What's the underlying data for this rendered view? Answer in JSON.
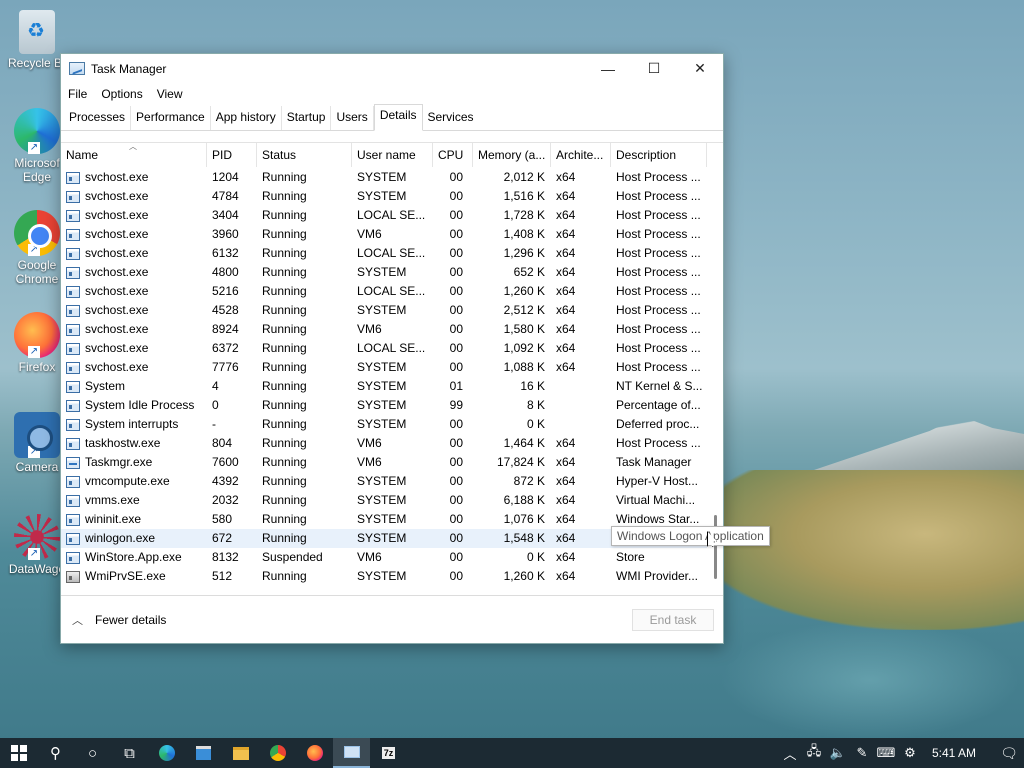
{
  "desktop": {
    "icons": [
      {
        "label": "Recycle Bin",
        "icon": "recycle-bin-icon"
      },
      {
        "label": "Microsoft Edge",
        "icon": "edge-icon"
      },
      {
        "label": "Google Chrome",
        "icon": "chrome-icon"
      },
      {
        "label": "Firefox",
        "icon": "firefox-icon"
      },
      {
        "label": "Camera",
        "icon": "camera-icon"
      },
      {
        "label": "DataWagon",
        "icon": "datawagon-icon"
      }
    ],
    "display_labels": [
      "Recycle Bi",
      "Microsof\nEdge",
      "Google\nChrome",
      "Firefox",
      "Camera",
      "DataWago"
    ]
  },
  "window": {
    "title": "Task Manager",
    "controls": {
      "minimize": "—",
      "maximize": "☐",
      "close": "✕"
    }
  },
  "menu": [
    "File",
    "Options",
    "View"
  ],
  "tabs": [
    "Processes",
    "Performance",
    "App history",
    "Startup",
    "Users",
    "Details",
    "Services"
  ],
  "active_tab": "Details",
  "columns": [
    "Name",
    "PID",
    "Status",
    "User name",
    "CPU",
    "Memory (a...",
    "Archite...",
    "Description"
  ],
  "rows": [
    {
      "name": "svchost.exe",
      "pid": "1204",
      "status": "Running",
      "user": "SYSTEM",
      "cpu": "00",
      "mem": "2,012 K",
      "arch": "x64",
      "desc": "Host Process ..."
    },
    {
      "name": "svchost.exe",
      "pid": "4784",
      "status": "Running",
      "user": "SYSTEM",
      "cpu": "00",
      "mem": "1,516 K",
      "arch": "x64",
      "desc": "Host Process ..."
    },
    {
      "name": "svchost.exe",
      "pid": "3404",
      "status": "Running",
      "user": "LOCAL SE...",
      "cpu": "00",
      "mem": "1,728 K",
      "arch": "x64",
      "desc": "Host Process ..."
    },
    {
      "name": "svchost.exe",
      "pid": "3960",
      "status": "Running",
      "user": "VM6",
      "cpu": "00",
      "mem": "1,408 K",
      "arch": "x64",
      "desc": "Host Process ..."
    },
    {
      "name": "svchost.exe",
      "pid": "6132",
      "status": "Running",
      "user": "LOCAL SE...",
      "cpu": "00",
      "mem": "1,296 K",
      "arch": "x64",
      "desc": "Host Process ..."
    },
    {
      "name": "svchost.exe",
      "pid": "4800",
      "status": "Running",
      "user": "SYSTEM",
      "cpu": "00",
      "mem": "652 K",
      "arch": "x64",
      "desc": "Host Process ..."
    },
    {
      "name": "svchost.exe",
      "pid": "5216",
      "status": "Running",
      "user": "LOCAL SE...",
      "cpu": "00",
      "mem": "1,260 K",
      "arch": "x64",
      "desc": "Host Process ..."
    },
    {
      "name": "svchost.exe",
      "pid": "4528",
      "status": "Running",
      "user": "SYSTEM",
      "cpu": "00",
      "mem": "2,512 K",
      "arch": "x64",
      "desc": "Host Process ..."
    },
    {
      "name": "svchost.exe",
      "pid": "8924",
      "status": "Running",
      "user": "VM6",
      "cpu": "00",
      "mem": "1,580 K",
      "arch": "x64",
      "desc": "Host Process ..."
    },
    {
      "name": "svchost.exe",
      "pid": "6372",
      "status": "Running",
      "user": "LOCAL SE...",
      "cpu": "00",
      "mem": "1,092 K",
      "arch": "x64",
      "desc": "Host Process ..."
    },
    {
      "name": "svchost.exe",
      "pid": "7776",
      "status": "Running",
      "user": "SYSTEM",
      "cpu": "00",
      "mem": "1,088 K",
      "arch": "x64",
      "desc": "Host Process ..."
    },
    {
      "name": "System",
      "pid": "4",
      "status": "Running",
      "user": "SYSTEM",
      "cpu": "01",
      "mem": "16 K",
      "arch": "",
      "desc": "NT Kernel & S..."
    },
    {
      "name": "System Idle Process",
      "pid": "0",
      "status": "Running",
      "user": "SYSTEM",
      "cpu": "99",
      "mem": "8 K",
      "arch": "",
      "desc": "Percentage of..."
    },
    {
      "name": "System interrupts",
      "pid": "-",
      "status": "Running",
      "user": "SYSTEM",
      "cpu": "00",
      "mem": "0 K",
      "arch": "",
      "desc": "Deferred proc..."
    },
    {
      "name": "taskhostw.exe",
      "pid": "804",
      "status": "Running",
      "user": "VM6",
      "cpu": "00",
      "mem": "1,464 K",
      "arch": "x64",
      "desc": "Host Process ..."
    },
    {
      "name": "Taskmgr.exe",
      "pid": "7600",
      "status": "Running",
      "user": "VM6",
      "cpu": "00",
      "mem": "17,824 K",
      "arch": "x64",
      "desc": "Task Manager"
    },
    {
      "name": "vmcompute.exe",
      "pid": "4392",
      "status": "Running",
      "user": "SYSTEM",
      "cpu": "00",
      "mem": "872 K",
      "arch": "x64",
      "desc": "Hyper-V Host..."
    },
    {
      "name": "vmms.exe",
      "pid": "2032",
      "status": "Running",
      "user": "SYSTEM",
      "cpu": "00",
      "mem": "6,188 K",
      "arch": "x64",
      "desc": "Virtual Machi..."
    },
    {
      "name": "wininit.exe",
      "pid": "580",
      "status": "Running",
      "user": "SYSTEM",
      "cpu": "00",
      "mem": "1,076 K",
      "arch": "x64",
      "desc": "Windows Star..."
    },
    {
      "name": "winlogon.exe",
      "pid": "672",
      "status": "Running",
      "user": "SYSTEM",
      "cpu": "00",
      "mem": "1,548 K",
      "arch": "x64",
      "desc": "Windows Logon Application"
    },
    {
      "name": "WinStore.App.exe",
      "pid": "8132",
      "status": "Suspended",
      "user": "VM6",
      "cpu": "00",
      "mem": "0 K",
      "arch": "x64",
      "desc": "Store"
    },
    {
      "name": "WmiPrvSE.exe",
      "pid": "512",
      "status": "Running",
      "user": "SYSTEM",
      "cpu": "00",
      "mem": "1,260 K",
      "arch": "x64",
      "desc": "WMI Provider..."
    }
  ],
  "highlighted_row": 19,
  "tooltip": "Windows Logon Application",
  "footer": {
    "fewer_details": "Fewer details",
    "end_task": "End task"
  },
  "taskbar": {
    "clock": "5:41 AM",
    "apps": [
      "start-icon",
      "search-icon",
      "cortana-icon",
      "task-view-icon",
      "edge-icon",
      "store-icon",
      "file-explorer-icon",
      "chrome-icon",
      "firefox-icon",
      "task-manager-icon",
      "7zip-icon"
    ],
    "seven_zip_label": "7z"
  }
}
